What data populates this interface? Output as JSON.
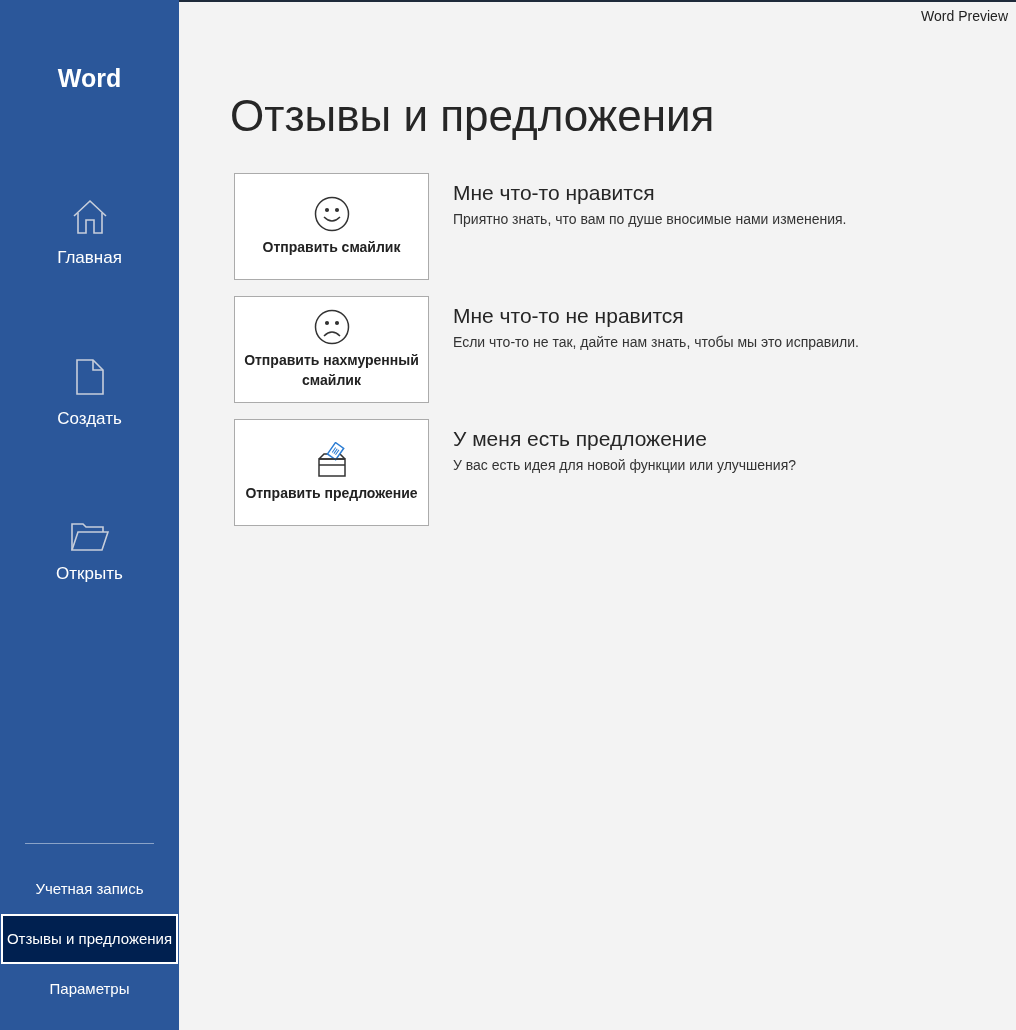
{
  "app_title": "Word Preview",
  "sidebar": {
    "logo": "Word",
    "items": [
      {
        "kind": "home",
        "label": "Главная"
      },
      {
        "kind": "new",
        "label": "Создать"
      },
      {
        "kind": "open",
        "label": "Открыть"
      }
    ],
    "bottom_items": [
      {
        "label": "Учетная запись",
        "selected": false
      },
      {
        "label": "Отзывы и предложения",
        "selected": true
      },
      {
        "label": "Параметры",
        "selected": false
      }
    ]
  },
  "page_title": "Отзывы и предложения",
  "feedback": [
    {
      "kind": "smile",
      "button": "Отправить смайлик",
      "heading": "Мне что-то нравится",
      "description": "Приятно знать, что вам по душе вносимые нами изменения."
    },
    {
      "kind": "frown",
      "button": "Отправить нахмуренный смайлик",
      "heading": "Мне что-то не нравится",
      "description": "Если что-то не так, дайте нам знать, чтобы мы это исправили."
    },
    {
      "kind": "suggestion",
      "button": "Отправить предложение",
      "heading": "У меня есть предложение",
      "description": "У вас есть идея для новой функции или улучшения?"
    }
  ]
}
